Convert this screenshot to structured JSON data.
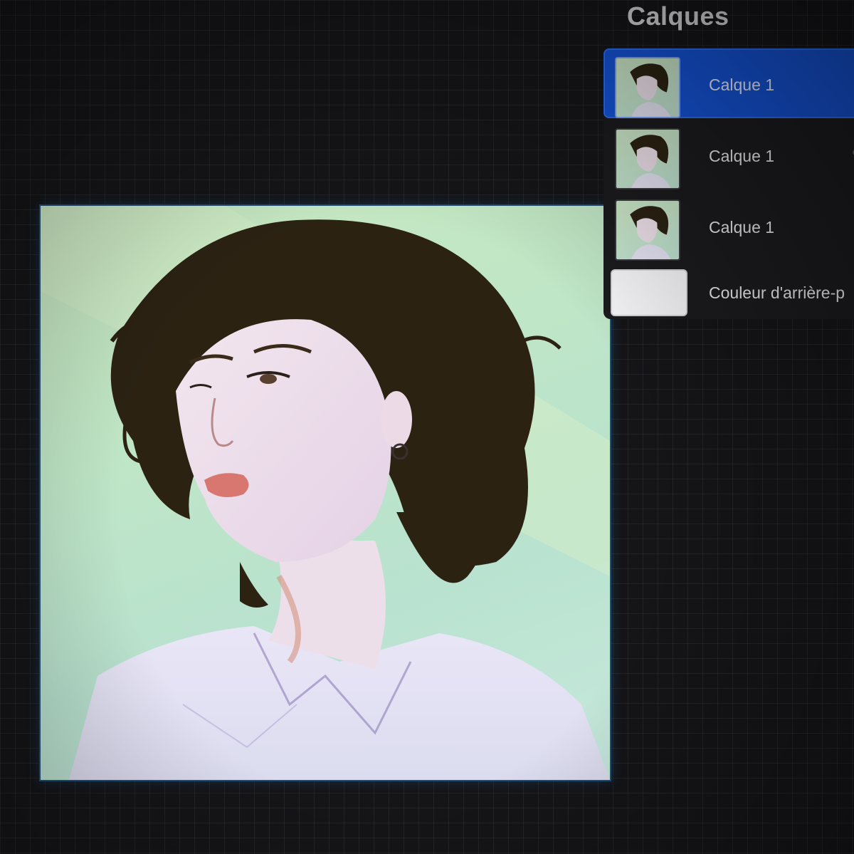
{
  "panel": {
    "title": "Calques"
  },
  "layers": [
    {
      "name": "Calque 1",
      "selected": true,
      "thumbnail": "portrait"
    },
    {
      "name": "Calque 1",
      "selected": false,
      "thumbnail": "portrait"
    },
    {
      "name": "Calque 1",
      "selected": false,
      "thumbnail": "portrait"
    },
    {
      "name": "Couleur d'arrière-p",
      "selected": false,
      "thumbnail": "blank"
    }
  ],
  "colors": {
    "accent": "#1553d6",
    "canvas_bg": "#c4e7c8",
    "workspace": "#151518"
  }
}
